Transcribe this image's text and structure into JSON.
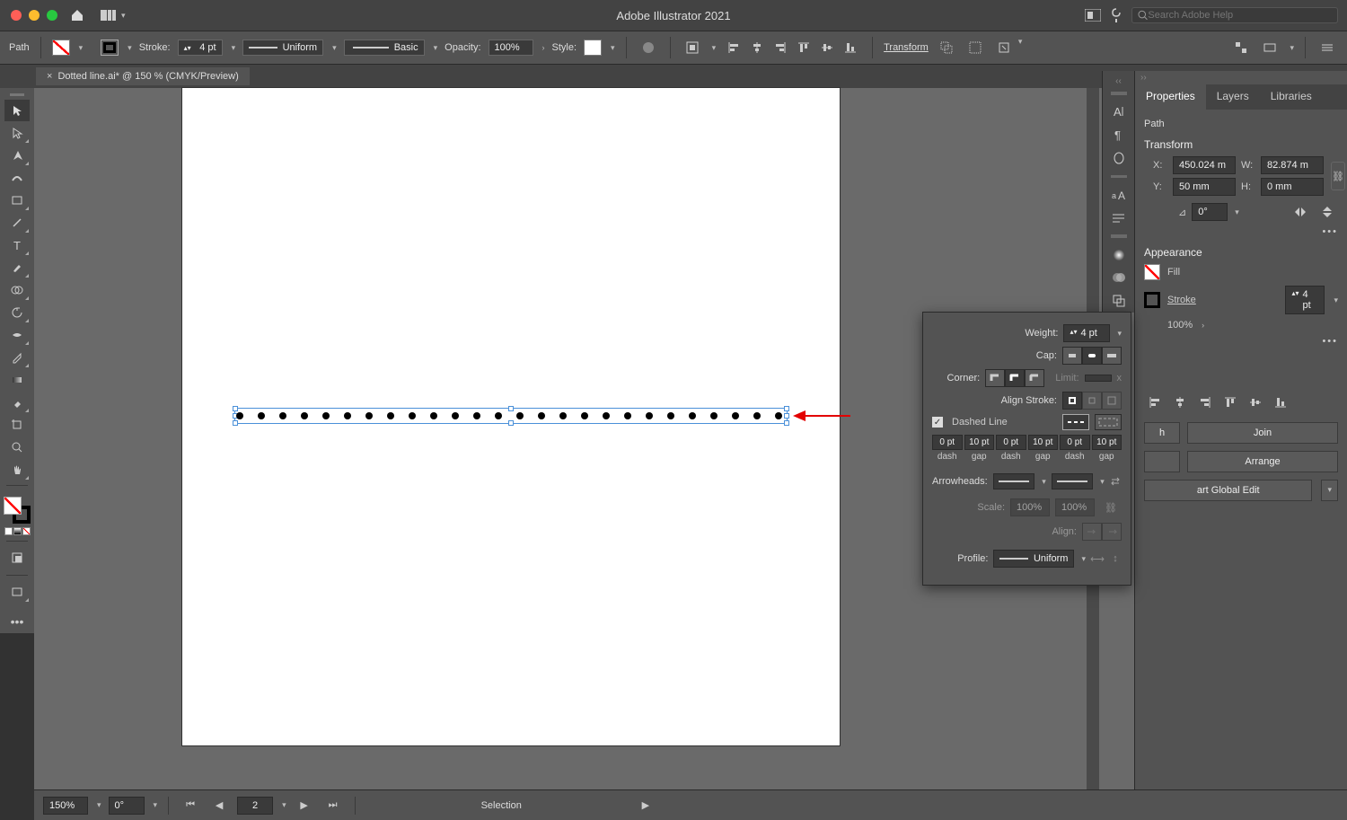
{
  "titlebar": {
    "app_title": "Adobe Illustrator 2021",
    "search_placeholder": "Search Adobe Help"
  },
  "controlbar": {
    "selection_label": "Path",
    "stroke_label": "Stroke:",
    "stroke_weight": "4 pt",
    "profile_uniform": "Uniform",
    "brush_basic": "Basic",
    "opacity_label": "Opacity:",
    "opacity_value": "100%",
    "style_label": "Style:",
    "transform_label": "Transform"
  },
  "tab": {
    "doc_name": "Dotted line.ai* @ 150 % (CMYK/Preview)"
  },
  "properties": {
    "tabs": {
      "properties": "Properties",
      "layers": "Layers",
      "libraries": "Libraries"
    },
    "selection_kind": "Path",
    "transform_title": "Transform",
    "x_label": "X:",
    "x_val": "450.024 m",
    "y_label": "Y:",
    "y_val": "50 mm",
    "w_label": "W:",
    "w_val": "82.874 m",
    "h_label": "H:",
    "h_val": "0 mm",
    "angle": "0°",
    "appearance_title": "Appearance",
    "fill_label": "Fill",
    "stroke_label": "Stroke",
    "stroke_val": "4 pt",
    "opacity_val": "100%",
    "join_btn": "Join",
    "arrange_btn": "Arrange",
    "ge_btn": "art Global Edit"
  },
  "stroke_panel": {
    "weight_label": "Weight:",
    "weight_val": "4 pt",
    "cap_label": "Cap:",
    "corner_label": "Corner:",
    "limit_label": "Limit:",
    "limit_val": "",
    "align_label": "Align Stroke:",
    "dashed_label": "Dashed Line",
    "dash_values": [
      "0 pt",
      "10 pt",
      "0 pt",
      "10 pt",
      "0 pt",
      "10 pt"
    ],
    "dash_labels": [
      "dash",
      "gap",
      "dash",
      "gap",
      "dash",
      "gap"
    ],
    "arrowheads_label": "Arrowheads:",
    "scale_label": "Scale:",
    "scale_a": "100%",
    "scale_b": "100%",
    "align_arrow_label": "Align:",
    "profile_label": "Profile:",
    "profile_val": "Uniform"
  },
  "statusbar": {
    "zoom": "150%",
    "rotation": "0°",
    "artboard_num": "2",
    "tool": "Selection"
  }
}
